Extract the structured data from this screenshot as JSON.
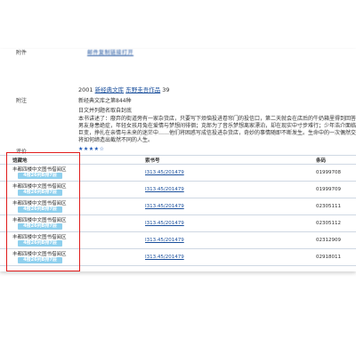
{
  "detail": {
    "prev_label": "附件",
    "prev_value_blurred": "邮件复制链接打开",
    "pub_year": "2001",
    "series_link_1": "新经典文库",
    "series_link_2": "东野圭吾作品",
    "series_vol": "39",
    "note_label": "附注",
    "note_1": "新经典文库之第844种",
    "note_2": "日文并列题名取自封底",
    "summary": "本书讲述了：廢弃的街道旁有一家杂货店，只要写下烦恼投进卷帘门的投信口，第二天就会在店后的牛奶箱里得到回答：因男友身患绝症，年轻女孩月兔在爱情与梦想间徘徊；克郎为了音乐梦想离家漂泊，却在现实中寸步难行；少年浩介面临家庭巨变，挣扎在亲情与未来的迷茫中……他们将困惑写成信投进杂货店，奇妙的事情随即不断发生。生命中的一次偶然交会，将如何缔造出截然不同的人生。",
    "rating_label": "评价",
    "rating_stars": "★★★★☆"
  },
  "holdings": {
    "headers": {
      "location": "馆藏地",
      "callno": "索书号",
      "barcode": "条码"
    },
    "rows": [
      {
        "location": "丰都四楼中文图书借阅区",
        "badge": "4楼26列B排7层",
        "callno": "I313.45/201479",
        "barcode": "01999708"
      },
      {
        "location": "丰都四楼中文图书借阅区",
        "badge": "4楼26列B排7层",
        "callno": "I313.45/201479",
        "barcode": "01999709"
      },
      {
        "location": "丰都四楼中文图书借阅区",
        "badge": "4楼26列B排7层",
        "callno": "I313.45/201479",
        "barcode": "02305111"
      },
      {
        "location": "丰都四楼中文图书借阅区",
        "badge": "4楼26列B排7层",
        "callno": "I313.45/201479",
        "barcode": "02305112"
      },
      {
        "location": "丰都四楼中文图书借阅区",
        "badge": "4楼26列B排7层",
        "callno": "I313.45/201479",
        "barcode": "02312909"
      },
      {
        "location": "丰都四楼中文图书借阅区",
        "badge": "4楼26列B排7层",
        "callno": "I313.45/201479",
        "barcode": "02918011"
      }
    ]
  },
  "colors": {
    "highlight_border": "#e01b1b",
    "badge_bg": "#8fd0ee",
    "link": "#1a4f9c"
  }
}
